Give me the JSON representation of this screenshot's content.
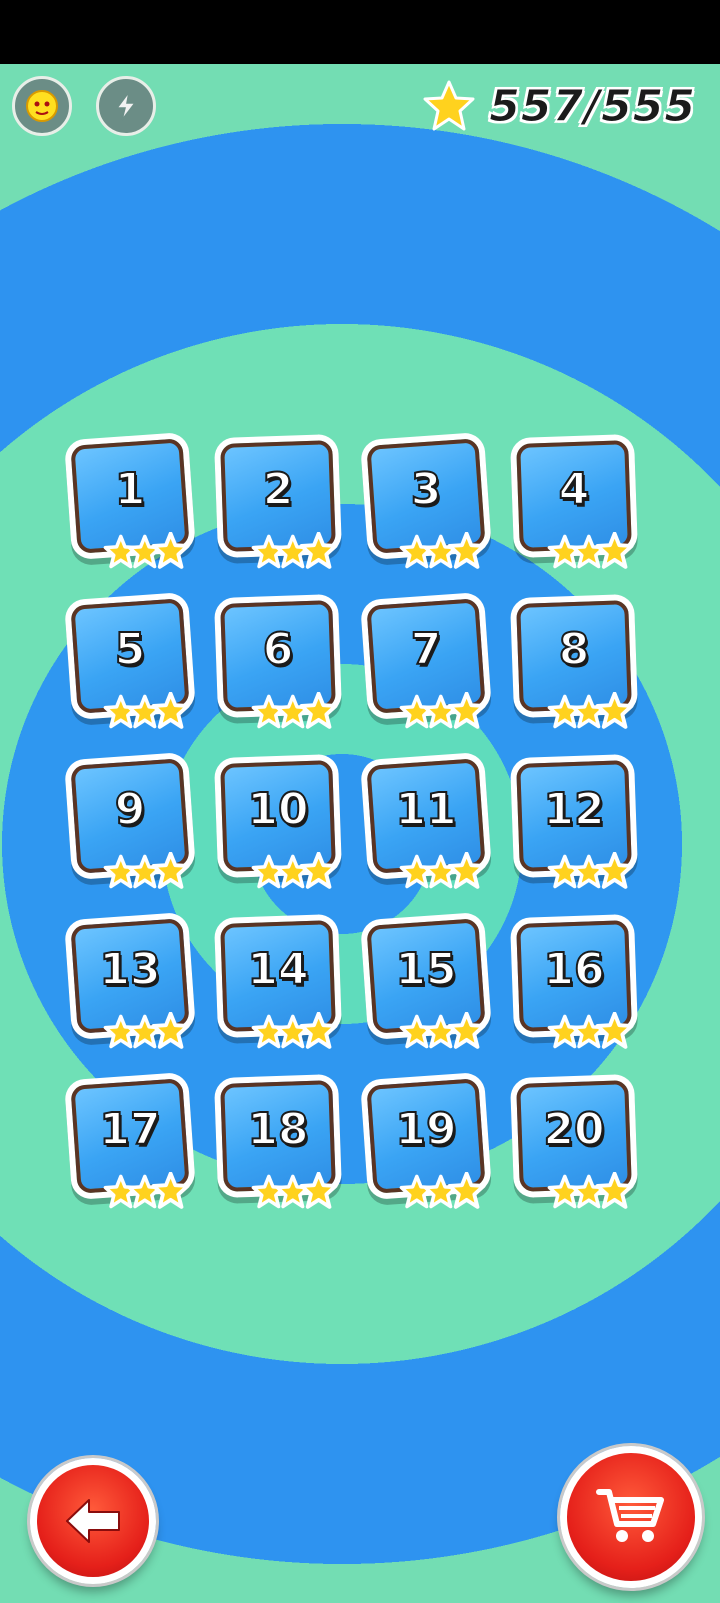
{
  "header": {
    "stars_collected": "557/555",
    "icons": [
      "character-icon",
      "lightning-icon",
      "star-icon"
    ]
  },
  "levels": [
    {
      "number": "1",
      "stars": 3
    },
    {
      "number": "2",
      "stars": 3
    },
    {
      "number": "3",
      "stars": 3
    },
    {
      "number": "4",
      "stars": 3
    },
    {
      "number": "5",
      "stars": 3
    },
    {
      "number": "6",
      "stars": 3
    },
    {
      "number": "7",
      "stars": 3
    },
    {
      "number": "8",
      "stars": 3
    },
    {
      "number": "9",
      "stars": 3
    },
    {
      "number": "10",
      "stars": 3
    },
    {
      "number": "11",
      "stars": 3
    },
    {
      "number": "12",
      "stars": 3
    },
    {
      "number": "13",
      "stars": 3
    },
    {
      "number": "14",
      "stars": 3
    },
    {
      "number": "15",
      "stars": 3
    },
    {
      "number": "16",
      "stars": 3
    },
    {
      "number": "17",
      "stars": 3
    },
    {
      "number": "18",
      "stars": 3
    },
    {
      "number": "19",
      "stars": 3
    },
    {
      "number": "20",
      "stars": 3
    }
  ],
  "footer": {
    "back_icon": "arrow-left-icon",
    "shop_icon": "shopping-cart-icon"
  },
  "colors": {
    "star": "#ffd21e",
    "tile": "#3aa4f4",
    "button": "#e5201a"
  }
}
